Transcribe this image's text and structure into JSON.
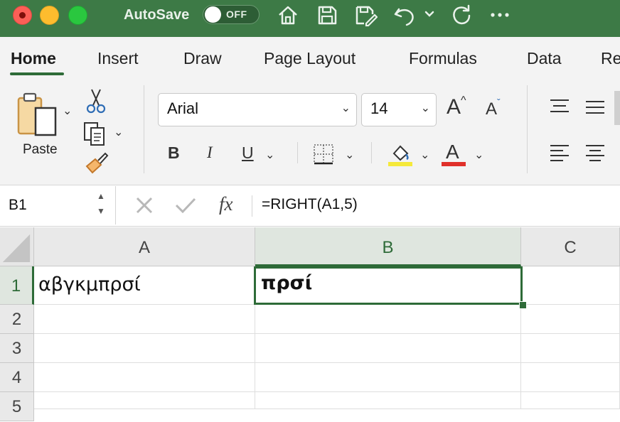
{
  "window": {
    "autosave_label": "AutoSave",
    "autosave_state": "OFF"
  },
  "tabs": [
    "Home",
    "Insert",
    "Draw",
    "Page Layout",
    "Formulas",
    "Data",
    "Re"
  ],
  "ribbon": {
    "paste_label": "Paste",
    "font_name": "Arial",
    "font_size": "14",
    "bold": "B",
    "italic": "I",
    "underline": "U",
    "increase_font": "A",
    "decrease_font": "A",
    "font_color_glyph": "A",
    "highlight_color": "#f5e93a",
    "font_color": "#e0302a"
  },
  "formula_bar": {
    "name_box": "B1",
    "fx": "fx",
    "formula": "=RIGHT(A1,5)"
  },
  "sheet": {
    "columns": [
      "A",
      "B",
      "C"
    ],
    "rows": [
      "1",
      "2",
      "3",
      "4",
      "5"
    ],
    "cells": {
      "A1": "αβγκμπρσί",
      "B1": "πρσί"
    },
    "active_cell": "B1"
  },
  "colors": {
    "accent": "#2e6b38",
    "titlebar": "#3d7a46"
  }
}
